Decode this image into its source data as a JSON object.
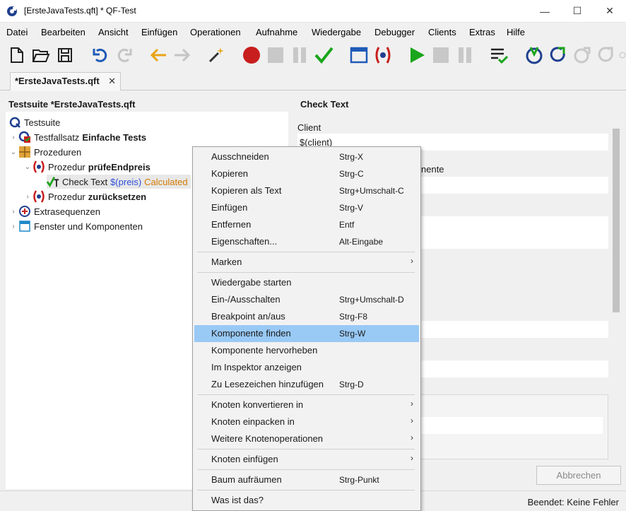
{
  "window": {
    "title": "[ErsteJavaTests.qft] * QF-Test",
    "min": "—",
    "max": "☐",
    "close": "✕"
  },
  "menu": [
    {
      "label": "Datei"
    },
    {
      "label": "Bearbeiten"
    },
    {
      "label": "Ansicht"
    },
    {
      "label": "Einfügen"
    },
    {
      "label": "Operationen"
    },
    {
      "label": "Aufnahme"
    },
    {
      "label": "Wiedergabe"
    },
    {
      "label": "Debugger"
    },
    {
      "label": "Clients"
    },
    {
      "label": "Extras"
    },
    {
      "label": "Hilfe"
    }
  ],
  "tab": {
    "label": "*ErsteJavaTests.qft",
    "close": "✕"
  },
  "tree": {
    "title": "Testsuite *ErsteJavaTests.qft",
    "nodes": [
      {
        "label": "Testsuite"
      },
      {
        "label": "Testfallsatz",
        "bold": "Einfache Tests"
      },
      {
        "label": "Prozeduren"
      },
      {
        "label": "Prozedur",
        "bold": "prüfeEndpreis"
      },
      {
        "label": "Check Text",
        "var": "$(preis)",
        "calc": "Calculated"
      },
      {
        "label": "Prozedur",
        "bold": "zurücksetzen"
      },
      {
        "label": "Extrasequenzen"
      },
      {
        "label": "Fenster und Komponenten"
      }
    ]
  },
  "detail": {
    "title": "Check Text",
    "client_label": "Client",
    "client_value": "$(client)",
    "component_label_fragment": "nente"
  },
  "buttons": {
    "cancel": "Abbrechen"
  },
  "status": {
    "text": "Beendet: Keine Fehler"
  },
  "context_menu": {
    "items": [
      {
        "label": "Ausschneiden",
        "shortcut": "Strg-X"
      },
      {
        "label": "Kopieren",
        "shortcut": "Strg-C"
      },
      {
        "label": "Kopieren als Text",
        "shortcut": "Strg+Umschalt-C"
      },
      {
        "label": "Einfügen",
        "shortcut": "Strg-V"
      },
      {
        "label": "Entfernen",
        "shortcut": "Entf"
      },
      {
        "label": "Eigenschaften...",
        "shortcut": "Alt-Eingabe"
      },
      {
        "label": "Marken",
        "submenu": "›"
      },
      {
        "label": "Wiedergabe starten"
      },
      {
        "label": "Ein-/Ausschalten",
        "shortcut": "Strg+Umschalt-D"
      },
      {
        "label": "Breakpoint an/aus",
        "shortcut": "Strg-F8"
      },
      {
        "label": "Komponente finden",
        "shortcut": "Strg-W"
      },
      {
        "label": "Komponente hervorheben"
      },
      {
        "label": "Im Inspektor anzeigen"
      },
      {
        "label": "Zu Lesezeichen hinzufügen",
        "shortcut": "Strg-D"
      },
      {
        "label": "Knoten konvertieren in",
        "submenu": "›"
      },
      {
        "label": "Knoten einpacken in",
        "submenu": "›"
      },
      {
        "label": "Weitere Knotenoperationen",
        "submenu": "›"
      },
      {
        "label": "Knoten einfügen",
        "submenu": "›"
      },
      {
        "label": "Baum aufräumen",
        "shortcut": "Strg-Punkt"
      },
      {
        "label": "Was ist das?"
      }
    ]
  },
  "colors": {
    "highlight": "#99c9f5",
    "accent_blue": "#1f5ab8",
    "record_red": "#c81e1e",
    "play_green": "#1aa51a"
  }
}
